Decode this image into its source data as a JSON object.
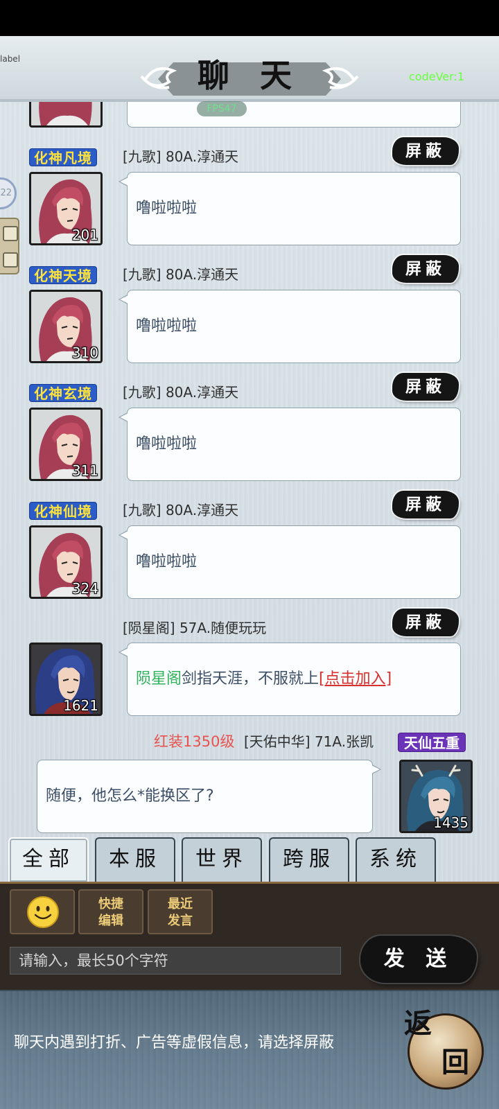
{
  "header": {
    "title": "聊 天",
    "debug_label": "label",
    "code_version": "codeVer:1",
    "fps": "FPS47"
  },
  "side_widgets": {
    "counter": "22"
  },
  "messages": [
    {
      "rank": "化神凡境",
      "name": "[九歌] 80A.淳通天",
      "block": "屏蔽",
      "level": "201",
      "text": "噜啦啦啦",
      "avatar": "red-hair"
    },
    {
      "rank": "化神天境",
      "name": "[九歌] 80A.淳通天",
      "block": "屏蔽",
      "level": "310",
      "text": "噜啦啦啦",
      "avatar": "red-hair"
    },
    {
      "rank": "化神玄境",
      "name": "[九歌] 80A.淳通天",
      "block": "屏蔽",
      "level": "311",
      "text": "噜啦啦啦",
      "avatar": "red-hair"
    },
    {
      "rank": "化神仙境",
      "name": "[九歌] 80A.淳通天",
      "block": "屏蔽",
      "level": "324",
      "text": "噜啦啦啦",
      "avatar": "red-hair"
    },
    {
      "name": "[陨星阁] 57A.随便玩玩",
      "block": "屏蔽",
      "level": "1621",
      "avatar": "blue-hair",
      "text_guild": "陨星阁",
      "text_body": "剑指天涯，不服就上",
      "text_link": "[点击加入]"
    }
  ],
  "own_message": {
    "vip": "红装1350级",
    "name": "[天佑中华] 71A.张凯",
    "rank": "天仙五重",
    "level": "1435",
    "text": "随便，他怎么*能换区了?",
    "avatar": "teal-hair-antlers"
  },
  "tabs": [
    {
      "label": "全部",
      "selected": true
    },
    {
      "label": "本服",
      "selected": false
    },
    {
      "label": "世界",
      "selected": false
    },
    {
      "label": "跨服",
      "selected": false
    },
    {
      "label": "系统",
      "selected": false
    }
  ],
  "toolbar": {
    "emoji_icon": "smiley-icon",
    "quick_edit": [
      "快捷",
      "编辑"
    ],
    "recent": [
      "最近",
      "发言"
    ]
  },
  "input": {
    "placeholder": "请输入，最长50个字符",
    "value": ""
  },
  "send_label": "发 送",
  "footer": {
    "notice": "聊天内遇到打折、广告等虚假信息，请选择屏蔽",
    "back_label": [
      "返",
      "回"
    ]
  },
  "colors": {
    "rank_badge_bg": "#2b5cc8",
    "rank_badge_text": "#ffe23b",
    "own_rank_bg": "#6b34b8",
    "vip_text": "#e8534f",
    "guild_text": "#2fb35a",
    "link_text": "#d8302c",
    "code_version": "#69ff3d",
    "panel_bg": "#2f2823",
    "footer_bg": "#5f7688"
  }
}
